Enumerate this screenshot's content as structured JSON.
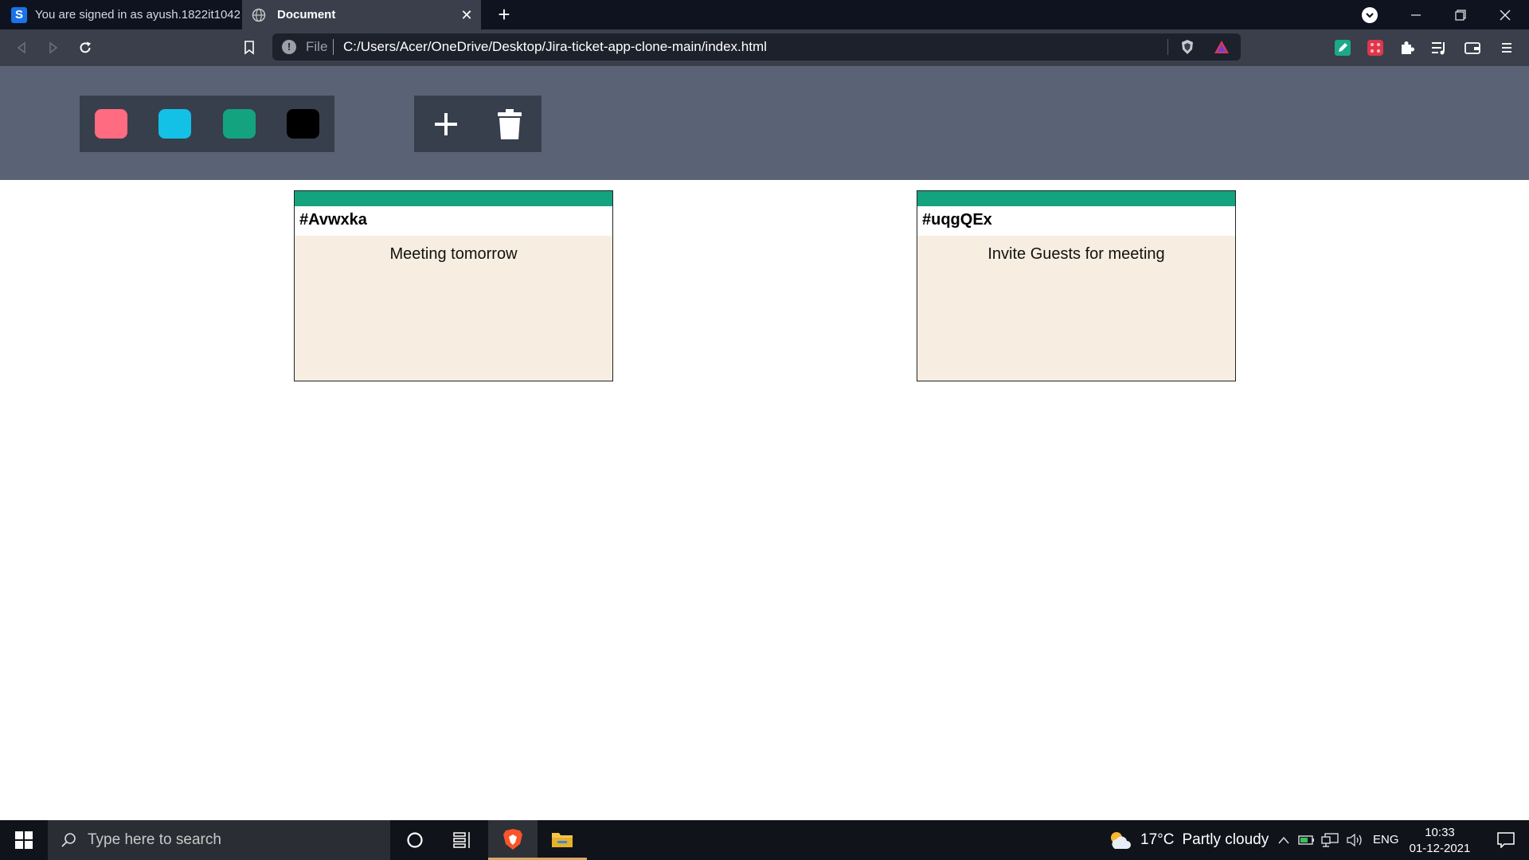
{
  "browser": {
    "tabs": [
      {
        "label": "You are signed in as ayush.1822it1042",
        "favicon": "S"
      },
      {
        "label": "Document",
        "active": true
      }
    ],
    "address": {
      "scheme_label": "File",
      "url": "C:/Users/Acer/OneDrive/Desktop/Jira-ticket-app-clone-main/index.html"
    }
  },
  "app": {
    "colors": [
      "#ff6b81",
      "#13c0e6",
      "#14a37f",
      "#000000"
    ],
    "tickets": [
      {
        "id": "#Avwxka",
        "task": "Meeting tomorrow",
        "color": "#14a37f"
      },
      {
        "id": "#uqgQEx",
        "task": "Invite Guests for meeting",
        "color": "#14a37f"
      }
    ]
  },
  "taskbar": {
    "search_placeholder": "Type here to search",
    "weather": {
      "temp": "17°C",
      "condition": "Partly cloudy"
    },
    "language": "ENG",
    "time": "10:33",
    "date": "01-12-2021"
  }
}
